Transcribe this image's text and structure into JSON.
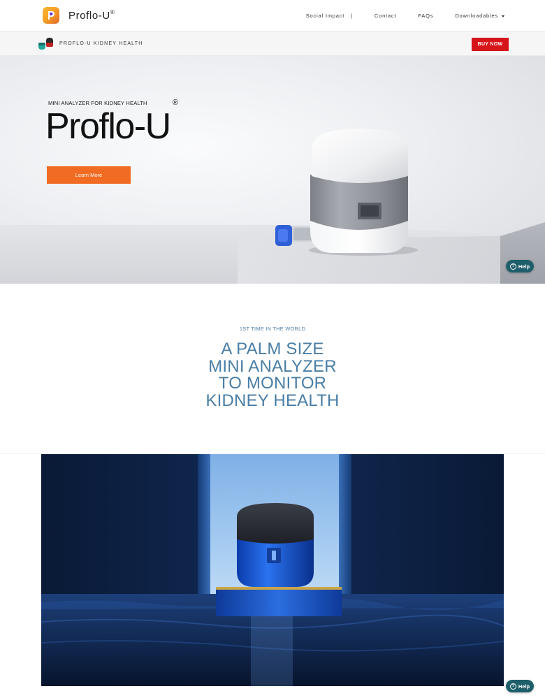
{
  "header": {
    "logo_text": "Proflo-U",
    "logo_mark": "®",
    "nav": {
      "social_impact": "Social Impact",
      "separator": "|",
      "contact": "Contact",
      "faqs": "FAQs",
      "downloadables": "Downloadables"
    }
  },
  "product_bar": {
    "name": "PROFLO-U KIDNEY HEALTH",
    "buy_label": "BUY NOW"
  },
  "hero": {
    "eyebrow": "MINI ANALYZER FOR KIDNEY HEALTH",
    "title": "Proflo-U",
    "title_mark": "®",
    "cta_label": "Learn More"
  },
  "intro": {
    "eyebrow": "1ST TIME IN THE WORLD",
    "title_lines": [
      "A PALM SIZE",
      "MINI ANALYZER",
      "TO MONITOR",
      "KIDNEY HEALTH"
    ]
  },
  "help_label": "Help",
  "help_symbol": "?",
  "colors": {
    "buy_red": "#d6151b",
    "cta_orange": "#f26b22",
    "headline_blue": "#4a7ea6",
    "help_teal": "#1f5f6b"
  }
}
